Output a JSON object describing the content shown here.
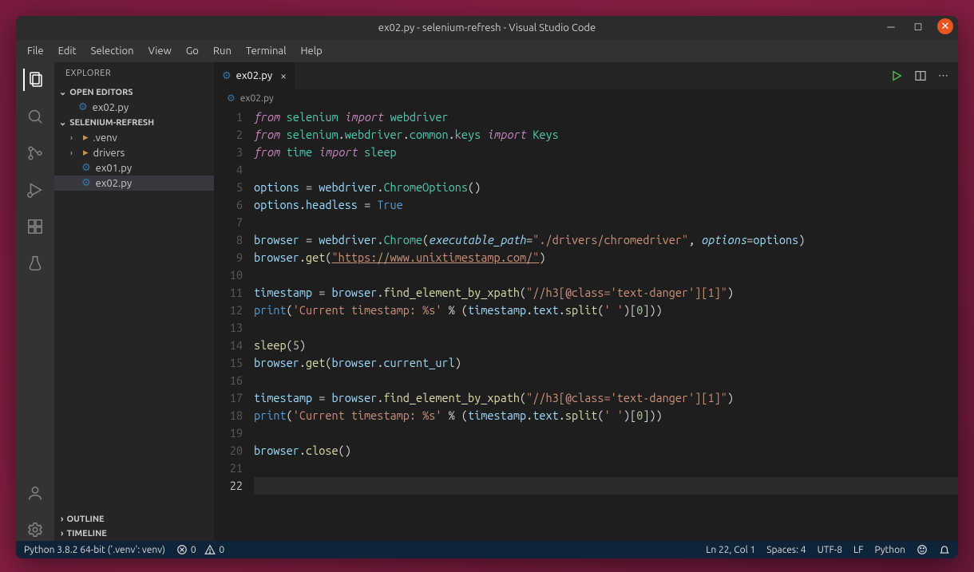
{
  "window": {
    "title": "ex02.py - selenium-refresh - Visual Studio Code"
  },
  "menubar": [
    "File",
    "Edit",
    "Selection",
    "View",
    "Go",
    "Run",
    "Terminal",
    "Help"
  ],
  "sidebar": {
    "title": "EXPLORER",
    "sections": {
      "open_editors": "OPEN EDITORS",
      "open_editors_items": [
        "ex02.py"
      ],
      "project": "SELENIUM-REFRESH",
      "project_items": [
        {
          "label": ".venv",
          "type": "folder"
        },
        {
          "label": "drivers",
          "type": "folder"
        },
        {
          "label": "ex01.py",
          "type": "py"
        },
        {
          "label": "ex02.py",
          "type": "py",
          "selected": true
        }
      ],
      "outline": "OUTLINE",
      "timeline": "TIMELINE"
    }
  },
  "tabs": {
    "active": "ex02.py"
  },
  "breadcrumb": "ex02.py",
  "code": {
    "lines": [
      {
        "n": 1,
        "html": "<span class='kw'>from</span> <span class='mod'>selenium</span> <span class='kw'>import</span> <span class='mod'>webdriver</span>"
      },
      {
        "n": 2,
        "html": "<span class='kw'>from</span> <span class='mod'>selenium</span><span class='pu'>.</span><span class='mod'>webdriver</span><span class='pu'>.</span><span class='mod'>common</span><span class='pu'>.</span><span class='mod'>keys</span> <span class='kw'>import</span> <span class='mod'>Keys</span>"
      },
      {
        "n": 3,
        "html": "<span class='kw'>from</span> <span class='mod'>time</span> <span class='kw'>import</span> <span class='mod'>sleep</span>"
      },
      {
        "n": 4,
        "html": ""
      },
      {
        "n": 5,
        "html": "<span class='nm'>options</span> <span class='op'>=</span> <span class='nm'>webdriver</span><span class='pu'>.</span><span class='cls'>ChromeOptions</span><span class='pu'>()</span>"
      },
      {
        "n": 6,
        "html": "<span class='nm'>options</span><span class='pu'>.</span><span class='nm'>headless</span> <span class='op'>=</span> <span class='cn'>True</span>"
      },
      {
        "n": 7,
        "html": ""
      },
      {
        "n": 8,
        "html": "<span class='nm'>browser</span> <span class='op'>=</span> <span class='nm'>webdriver</span><span class='pu'>.</span><span class='cls'>Chrome</span><span class='pu'>(</span><span class='pa'>executable_path</span><span class='op'>=</span><span class='st'>\"./drivers/chromedriver\"</span><span class='pu'>,</span> <span class='pa'>options</span><span class='op'>=</span><span class='nm'>options</span><span class='pu'>)</span>"
      },
      {
        "n": 9,
        "html": "<span class='nm'>browser</span><span class='pu'>.</span><span class='fn'>get</span><span class='pu'>(</span><span class='url'>\"https://www.unixtimestamp.com/\"</span><span class='pu'>)</span>"
      },
      {
        "n": 10,
        "html": ""
      },
      {
        "n": 11,
        "html": "<span class='nm'>timestamp</span> <span class='op'>=</span> <span class='nm'>browser</span><span class='pu'>.</span><span class='fn'>find_element_by_xpath</span><span class='pu'>(</span><span class='st'>\"//h3[@class='text-danger'][1]\"</span><span class='pu'>)</span>"
      },
      {
        "n": 12,
        "html": "<span class='fnlt'>print</span><span class='pu'>(</span><span class='st'>'Current timestamp: %s'</span> <span class='op'>%</span> <span class='pu'>(</span><span class='nm'>timestamp</span><span class='pu'>.</span><span class='nm'>text</span><span class='pu'>.</span><span class='fn'>split</span><span class='pu'>(</span><span class='st'>' '</span><span class='pu'>)[</span><span class='num'>0</span><span class='pu'>]))</span>"
      },
      {
        "n": 13,
        "html": ""
      },
      {
        "n": 14,
        "html": "<span class='fn'>sleep</span><span class='pu'>(</span><span class='num'>5</span><span class='pu'>)</span>"
      },
      {
        "n": 15,
        "html": "<span class='nm'>browser</span><span class='pu'>.</span><span class='fn'>get</span><span class='pu'>(</span><span class='nm'>browser</span><span class='pu'>.</span><span class='nm'>current_url</span><span class='pu'>)</span>"
      },
      {
        "n": 16,
        "html": ""
      },
      {
        "n": 17,
        "html": "<span class='nm'>timestamp</span> <span class='op'>=</span> <span class='nm'>browser</span><span class='pu'>.</span><span class='fn'>find_element_by_xpath</span><span class='pu'>(</span><span class='st'>\"//h3[@class='text-danger'][1]\"</span><span class='pu'>)</span>"
      },
      {
        "n": 18,
        "html": "<span class='fnlt'>print</span><span class='pu'>(</span><span class='st'>'Current timestamp: %s'</span> <span class='op'>%</span> <span class='pu'>(</span><span class='nm'>timestamp</span><span class='pu'>.</span><span class='nm'>text</span><span class='pu'>.</span><span class='fn'>split</span><span class='pu'>(</span><span class='st'>' '</span><span class='pu'>)[</span><span class='num'>0</span><span class='pu'>]))</span>"
      },
      {
        "n": 19,
        "html": ""
      },
      {
        "n": 20,
        "html": "<span class='nm'>browser</span><span class='pu'>.</span><span class='fn'>close</span><span class='pu'>()</span>"
      },
      {
        "n": 21,
        "html": ""
      },
      {
        "n": 22,
        "html": "",
        "current": true
      }
    ]
  },
  "status": {
    "python": "Python 3.8.2 64-bit ('.venv': venv)",
    "problems": "0",
    "warnings": "0",
    "pos": "Ln 22, Col 1",
    "spaces": "Spaces: 4",
    "enc": "UTF-8",
    "eol": "LF",
    "lang": "Python"
  }
}
